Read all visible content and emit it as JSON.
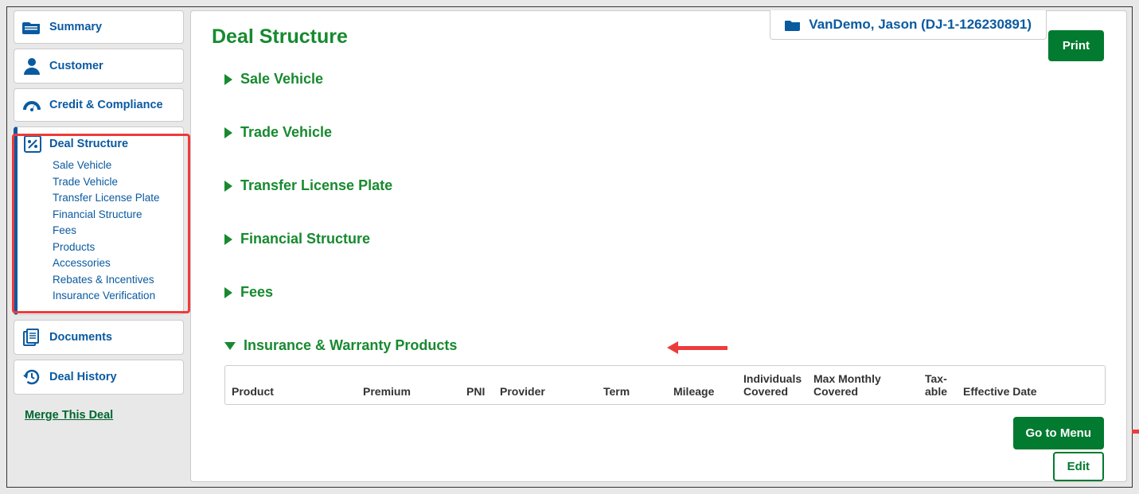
{
  "sidebar": {
    "items": {
      "summary": "Summary",
      "customer": "Customer",
      "credit": "Credit & Compliance",
      "deal": "Deal Structure",
      "documents": "Documents",
      "history": "Deal History"
    },
    "deal_sub": [
      "Sale Vehicle",
      "Trade Vehicle",
      "Transfer License Plate",
      "Financial Structure",
      "Fees",
      "Products",
      "Accessories",
      "Rebates & Incentives",
      "Insurance Verification"
    ],
    "merge_link": "Merge This Deal"
  },
  "header": {
    "deal_label": "VanDemo, Jason (DJ-1-126230891)",
    "print": "Print"
  },
  "main": {
    "title": "Deal Structure",
    "sections": {
      "sale_vehicle": "Sale Vehicle",
      "trade_vehicle": "Trade Vehicle",
      "transfer_license": "Transfer License Plate",
      "financial_structure": "Financial Structure",
      "fees": "Fees",
      "insurance_warranty": "Insurance & Warranty Products"
    },
    "table_headers": {
      "product": "Product",
      "premium": "Premium",
      "pni": "PNI",
      "provider": "Provider",
      "term": "Term",
      "mileage": "Mileage",
      "individuals": "Individuals Covered",
      "max_monthly": "Max Monthly Covered",
      "taxable": "Tax-able",
      "effective": "Effective Date"
    },
    "buttons": {
      "go_to_menu": "Go to Menu",
      "edit": "Edit"
    }
  }
}
